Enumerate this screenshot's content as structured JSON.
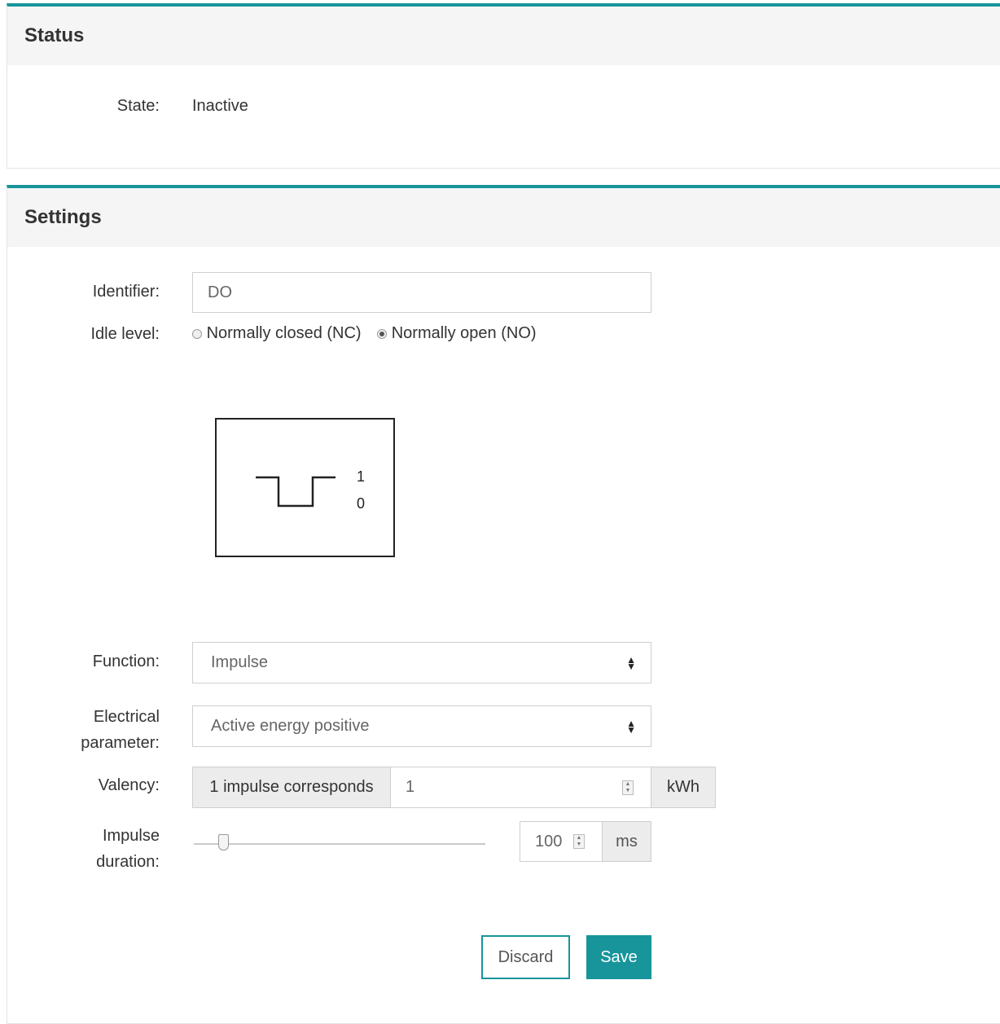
{
  "status": {
    "title": "Status",
    "state_label": "State:",
    "state_value": "Inactive"
  },
  "settings": {
    "title": "Settings",
    "identifier_label": "Identifier:",
    "identifier_value": "DO",
    "idle_level_label": "Idle level:",
    "idle_options": [
      {
        "label": "Normally closed (NC)",
        "selected": false
      },
      {
        "label": "Normally open (NO)",
        "selected": true
      }
    ],
    "diagram": {
      "level_high": "1",
      "level_low": "0"
    },
    "function_label": "Function:",
    "function_value": "Impulse",
    "electrical_label_line1": "Electrical",
    "electrical_label_line2": "parameter:",
    "electrical_value": "Active energy positive",
    "valency_label": "Valency:",
    "valency_prefix": "1 impulse corresponds",
    "valency_value": "1",
    "valency_unit": "kWh",
    "impulse_label_line1": "Impulse",
    "impulse_label_line2": "duration:",
    "impulse_value": "100",
    "impulse_unit": "ms",
    "impulse_slider_fraction": 0.1,
    "discard_label": "Discard",
    "save_label": "Save"
  },
  "colors": {
    "accent": "#17959b"
  }
}
